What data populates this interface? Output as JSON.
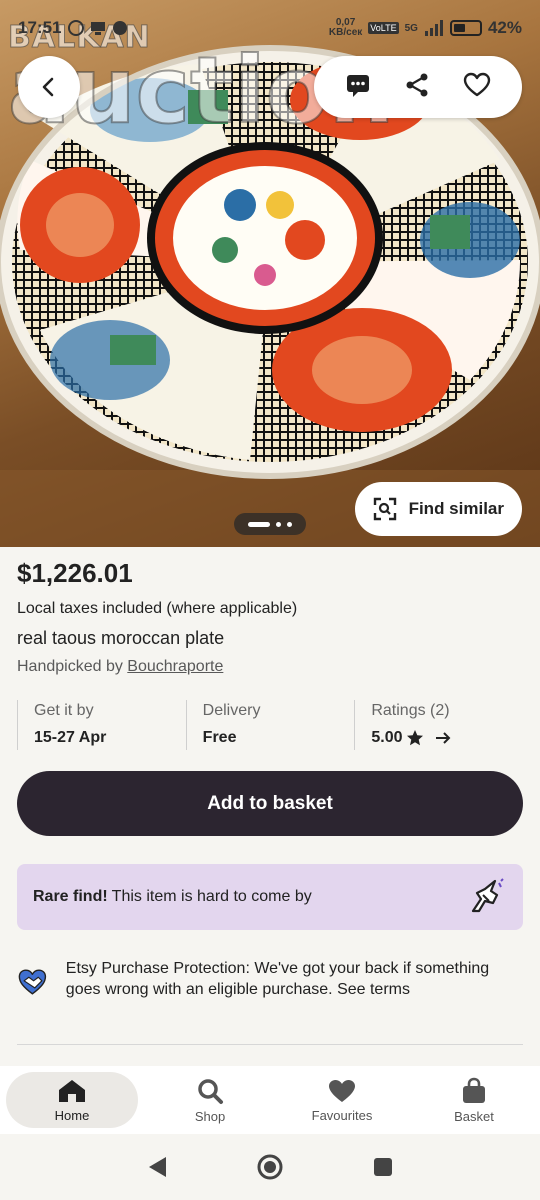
{
  "status_bar": {
    "time": "17:51",
    "network_speed": "0,07 KB/сек",
    "network_speed_value": "0,07",
    "network_speed_unit": "KB/сек",
    "network_type": "5G",
    "battery": "42%"
  },
  "watermark": {
    "small_text": "BALKAN",
    "big_text": "auction"
  },
  "gallery": {
    "find_similar_label": "Find similar",
    "page_count": 3,
    "current_page": 1
  },
  "product": {
    "price": "$1,226.01",
    "tax_note": "Local taxes included (where applicable)",
    "title": "real taous moroccan plate",
    "handpicked_prefix": "Handpicked by",
    "shop_name": "Bouchraporte"
  },
  "info": {
    "get_it_label": "Get it by",
    "get_it_value": "15-27 Apr",
    "delivery_label": "Delivery",
    "delivery_value": "Free",
    "ratings_label": "Ratings (2)",
    "ratings_value": "5.00"
  },
  "add_to_basket_label": "Add to basket",
  "rare_find": {
    "bold": "Rare find!",
    "text": "This item is hard to come by"
  },
  "protection": {
    "text": "Etsy Purchase Protection: We've got your back if something goes wrong with an eligible purchase. See terms"
  },
  "bottom_nav": {
    "items": [
      {
        "label": "Home",
        "icon": "home-icon",
        "active": true
      },
      {
        "label": "Shop",
        "icon": "search-icon",
        "active": false
      },
      {
        "label": "Favourites",
        "icon": "heart-icon",
        "active": false
      },
      {
        "label": "Basket",
        "icon": "bag-icon",
        "active": false
      }
    ]
  },
  "colors": {
    "accent_dark": "#2c2530",
    "rare_bg": "#e3d6ee",
    "page_bg": "#f6f5f1"
  }
}
